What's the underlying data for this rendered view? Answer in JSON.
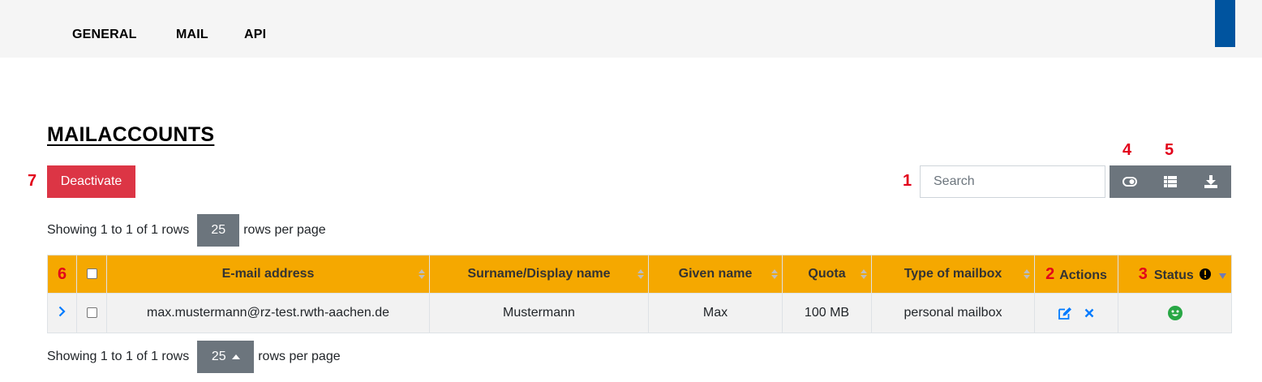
{
  "nav": {
    "items": [
      "GENERAL",
      "MAIL",
      "API"
    ]
  },
  "page": {
    "title": "MAILACCOUNTS"
  },
  "markers": {
    "m1": "1",
    "m2": "2",
    "m3": "3",
    "m4": "4",
    "m5": "5",
    "m6": "6",
    "m7": "7"
  },
  "actions": {
    "deactivate_label": "Deactivate"
  },
  "search": {
    "placeholder": "Search",
    "value": ""
  },
  "toolbar": {
    "icons": [
      "toggle-icon",
      "columns-icon",
      "download-icon"
    ]
  },
  "pagination": {
    "top": {
      "showing": "Showing 1 to 1 of 1 rows",
      "page_size": "25",
      "suffix": "rows per page"
    },
    "bottom": {
      "showing": "Showing 1 to 1 of 1 rows",
      "page_size": "25",
      "suffix": "rows per page"
    }
  },
  "table": {
    "columns": [
      "E-mail address",
      "Surname/Display name",
      "Given name",
      "Quota",
      "Type of mailbox",
      "Actions",
      "Status"
    ],
    "rows": [
      {
        "email": "max.mustermann@rz-test.rwth-aachen.de",
        "surname": "Mustermann",
        "given": "Max",
        "quota": "100 MB",
        "type": "personal mailbox"
      }
    ]
  },
  "colors": {
    "header_bg": "#f5a800",
    "danger": "#dc3545",
    "secondary": "#6c757d",
    "brand": "#00549f",
    "status_ok": "#28a745",
    "marker": "#e2001a",
    "link": "#007bff"
  }
}
